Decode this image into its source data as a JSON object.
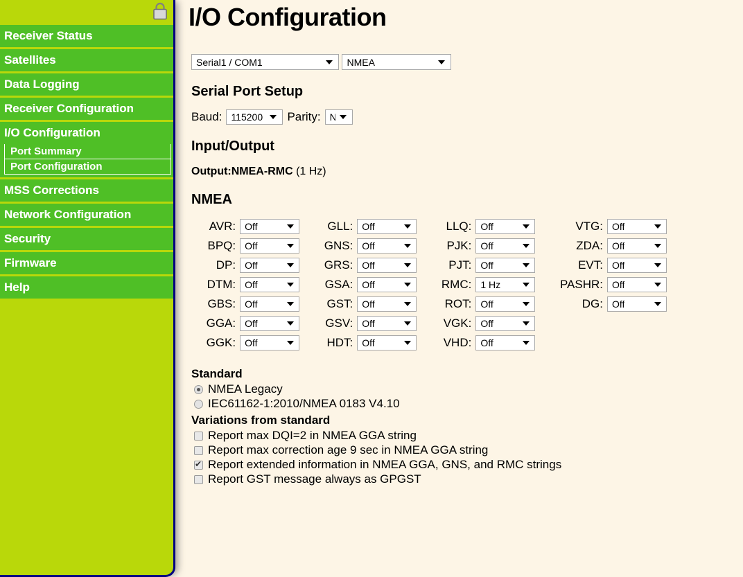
{
  "theme": {
    "page_bg": "#FDF5E6",
    "sidebar_bg": "#B9D80A",
    "menu_item_bg": "#4FBF26",
    "menu_text": "#FFFFFF",
    "sidebar_border": "#000080"
  },
  "sidebar": {
    "lock_icon": "lock-icon",
    "items": [
      {
        "label": "Receiver Status",
        "id": "receiver-status"
      },
      {
        "label": "Satellites",
        "id": "satellites"
      },
      {
        "label": "Data Logging",
        "id": "data-logging"
      },
      {
        "label": "Receiver Configuration",
        "id": "receiver-configuration"
      },
      {
        "label": "I/O Configuration",
        "id": "io-configuration"
      }
    ],
    "submenu": [
      {
        "label": "Port Summary",
        "id": "port-summary",
        "active": false
      },
      {
        "label": "Port Configuration",
        "id": "port-configuration",
        "active": true
      }
    ],
    "items_after": [
      {
        "label": "MSS Corrections",
        "id": "mss-corrections"
      },
      {
        "label": "Network Configuration",
        "id": "network-configuration"
      },
      {
        "label": "Security",
        "id": "security"
      },
      {
        "label": "Firmware",
        "id": "firmware"
      },
      {
        "label": "Help",
        "id": "help"
      }
    ]
  },
  "main": {
    "title": "I/O Configuration",
    "port_select": {
      "value": "Serial1 / COM1"
    },
    "type_select": {
      "value": "NMEA"
    },
    "serial_port_setup": {
      "heading": "Serial Port Setup",
      "baud_label": "Baud:",
      "baud_value": "115200",
      "parity_label": "Parity:",
      "parity_value": "N"
    },
    "input_output": {
      "heading": "Input/Output",
      "output_prefix": "Output:NMEA-RMC",
      "output_rate": " (1 Hz)"
    },
    "nmea": {
      "heading": "NMEA",
      "messages": [
        {
          "label": "AVR:",
          "value": "Off"
        },
        {
          "label": "GLL:",
          "value": "Off"
        },
        {
          "label": "LLQ:",
          "value": "Off"
        },
        {
          "label": "VTG:",
          "value": "Off"
        },
        {
          "label": "BPQ:",
          "value": "Off"
        },
        {
          "label": "GNS:",
          "value": "Off"
        },
        {
          "label": "PJK:",
          "value": "Off"
        },
        {
          "label": "ZDA:",
          "value": "Off"
        },
        {
          "label": "DP:",
          "value": "Off"
        },
        {
          "label": "GRS:",
          "value": "Off"
        },
        {
          "label": "PJT:",
          "value": "Off"
        },
        {
          "label": "EVT:",
          "value": "Off"
        },
        {
          "label": "DTM:",
          "value": "Off"
        },
        {
          "label": "GSA:",
          "value": "Off"
        },
        {
          "label": "RMC:",
          "value": "1 Hz"
        },
        {
          "label": "PASHR:",
          "value": "Off"
        },
        {
          "label": "GBS:",
          "value": "Off"
        },
        {
          "label": "GST:",
          "value": "Off"
        },
        {
          "label": "ROT:",
          "value": "Off"
        },
        {
          "label": "DG:",
          "value": "Off"
        },
        {
          "label": "GGA:",
          "value": "Off"
        },
        {
          "label": "GSV:",
          "value": "Off"
        },
        {
          "label": "VGK:",
          "value": "Off"
        },
        {
          "label": "",
          "value": ""
        },
        {
          "label": "GGK:",
          "value": "Off"
        },
        {
          "label": "HDT:",
          "value": "Off"
        },
        {
          "label": "VHD:",
          "value": "Off"
        },
        {
          "label": "",
          "value": ""
        }
      ]
    },
    "standard": {
      "heading": "Standard",
      "options": [
        {
          "label": "NMEA Legacy",
          "selected": true
        },
        {
          "label": "IEC61162-1:2010/NMEA 0183 V4.10",
          "selected": false
        }
      ]
    },
    "variations": {
      "heading": "Variations from standard",
      "options": [
        {
          "label": "Report max DQI=2 in NMEA GGA string",
          "checked": false
        },
        {
          "label": "Report max correction age 9 sec in NMEA GGA string",
          "checked": false
        },
        {
          "label": "Report extended information in NMEA GGA, GNS, and RMC strings",
          "checked": true
        },
        {
          "label": "Report GST message always as GPGST",
          "checked": false
        }
      ]
    }
  }
}
